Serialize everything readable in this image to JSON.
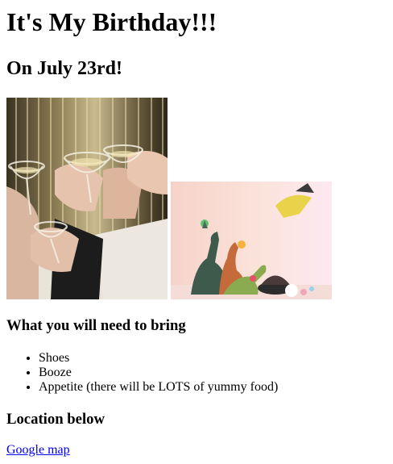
{
  "page": {
    "title": "It's My Birthday!!!",
    "subtitle": "On July 23rd!"
  },
  "images": {
    "photo_1": "champagne-toast-photo",
    "photo_2": "dinosaur-party-photo"
  },
  "bring": {
    "heading": "What you will need to bring",
    "items": [
      "Shoes",
      "Booze",
      "Appetite (there will be LOTS of yummy food)"
    ]
  },
  "location": {
    "heading": "Location below",
    "link_label": "Google map"
  },
  "colors": {
    "link": "#0000ee",
    "text": "#000000",
    "background": "#ffffff"
  }
}
